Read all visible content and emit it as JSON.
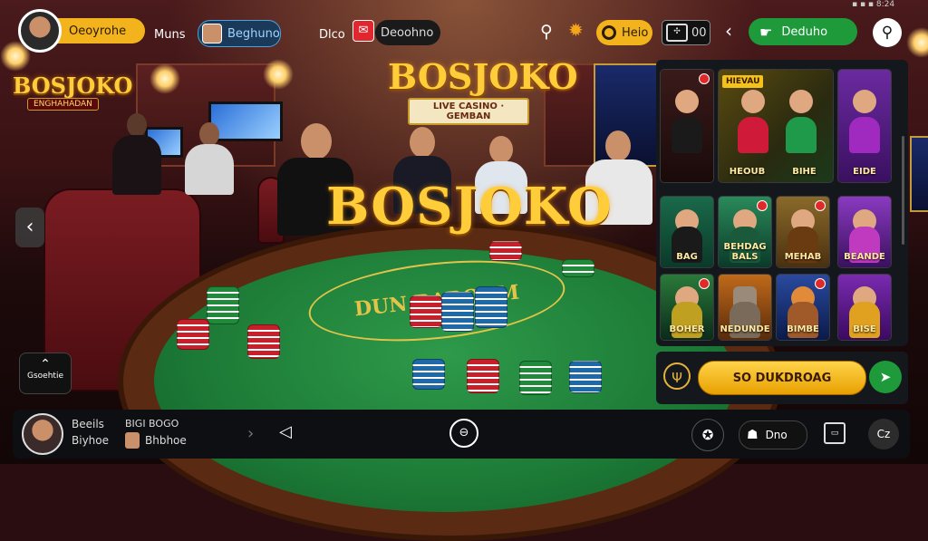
{
  "status_bar": {
    "text": "▪ ▪ ▪ 8:24"
  },
  "topbar": {
    "profile_name": "Oeoyrohe",
    "menu_label": "Muns",
    "user_pill_label": "Beghuno",
    "tab_label": "Dlco",
    "dark_pill_label": "Deoohno",
    "coin_label": "Heio",
    "counter_label": "00",
    "deposit_label": "Deduho"
  },
  "logos": {
    "main": "BOSJOKO",
    "top": "BOSJOKO",
    "top_tagline": "LIVE CASINO · GEMBAN",
    "corner": "BOSJOKO",
    "corner_tagline": "ENGHAHADAN"
  },
  "scene": {
    "felt_print": "DUN BAROOM"
  },
  "game_panel": {
    "featured_banner": "HIEVAU",
    "cards": [
      {
        "title": ""
      },
      {
        "title": "HEOUB"
      },
      {
        "title": "BIHE"
      },
      {
        "title": "EIDE"
      },
      {
        "title": "BAG"
      },
      {
        "title": "BEHDAG BALS"
      },
      {
        "title": "MEHAB"
      },
      {
        "title": "BEANDE"
      },
      {
        "title": "BOHER"
      },
      {
        "title": "NEDUNDE"
      },
      {
        "title": "BIMBE"
      },
      {
        "title": "BISE"
      }
    ],
    "download_label": "SO DUKDROAG"
  },
  "left_controls": {
    "corner_widget_label": "Gsoehtie"
  },
  "bottombar": {
    "name1": "Beeils",
    "name2": "Biyhoe",
    "label1": "BIGI BOGO",
    "label2": "Bhbhoe",
    "nav_pill_label": "Dno",
    "close_label": "Cz"
  },
  "colors": {
    "accent_gold": "#f3b31c",
    "accent_green": "#1e9a3a",
    "panel_bg": "#14171c"
  }
}
